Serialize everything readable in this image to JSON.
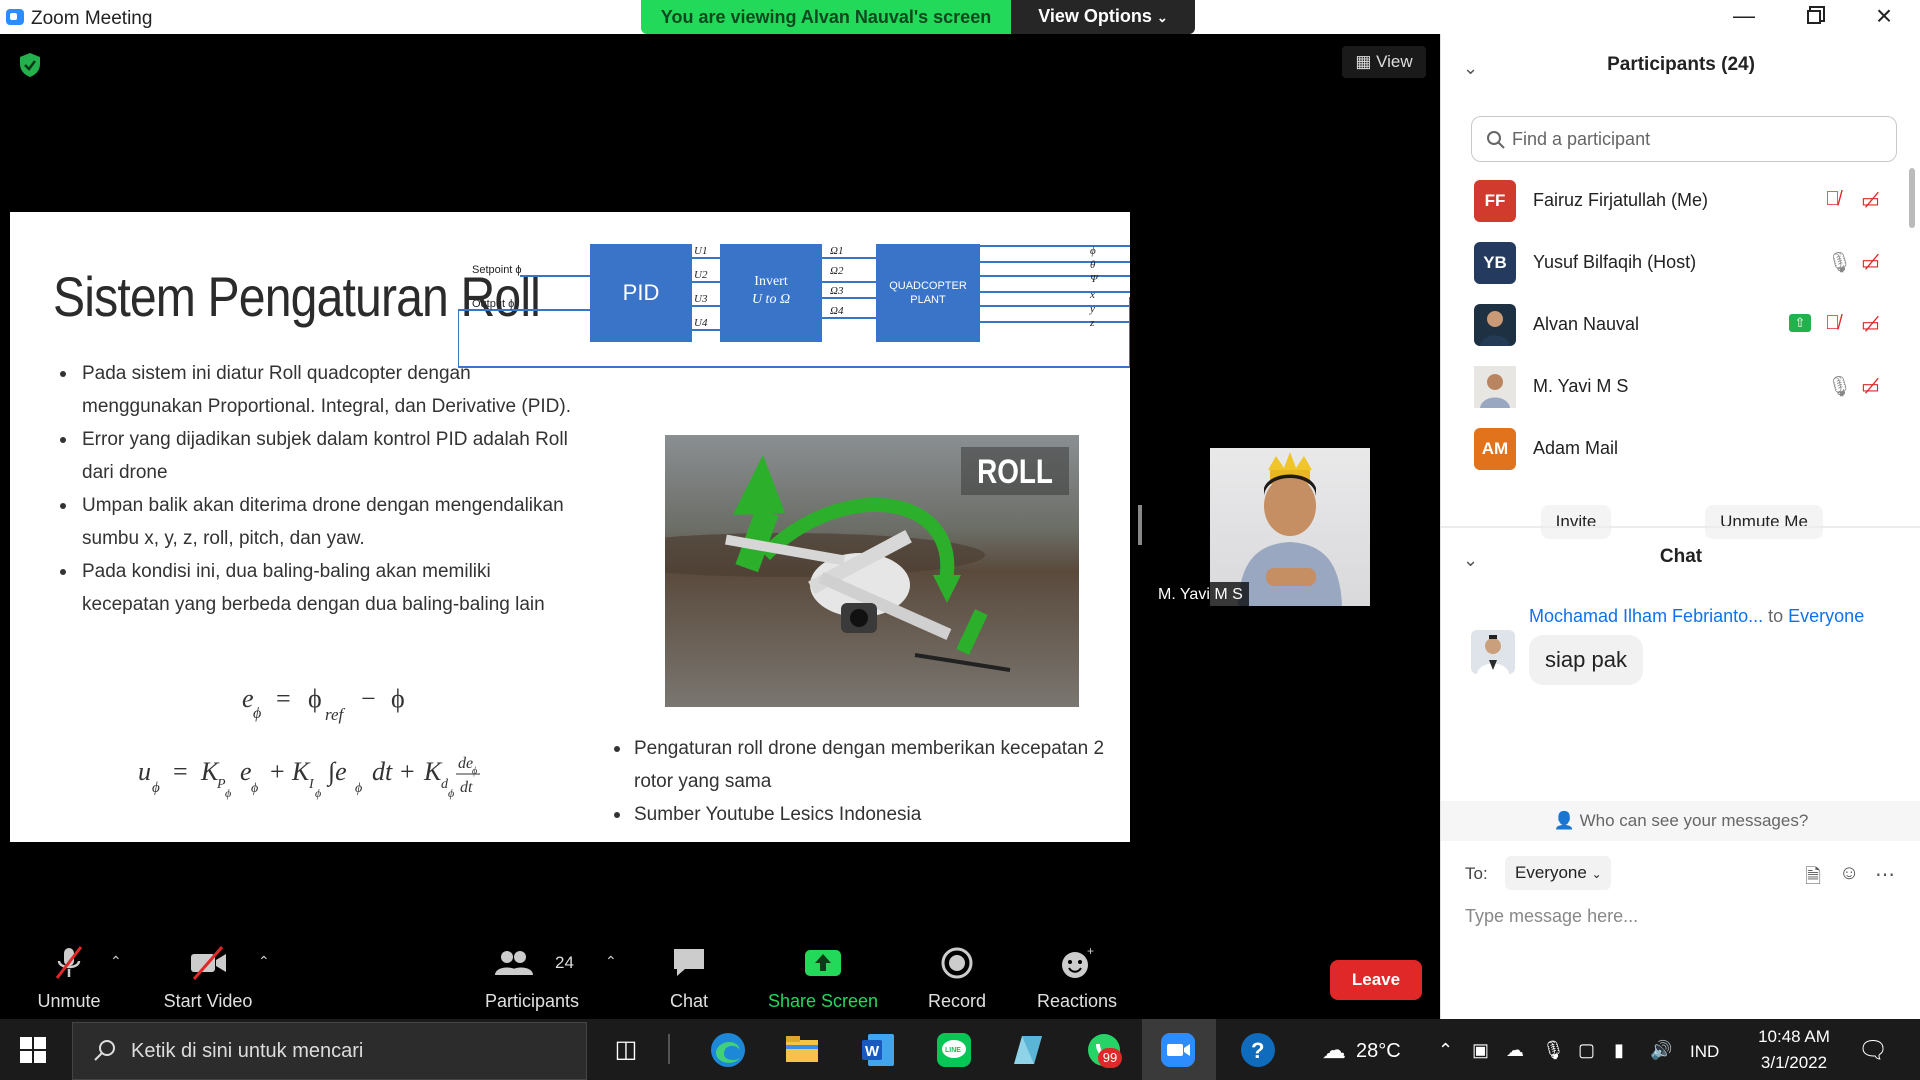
{
  "window": {
    "title": "Zoom Meeting",
    "viewing_banner": "You are viewing Alvan Nauval's screen",
    "view_options": "View Options",
    "view_button": "View"
  },
  "slide": {
    "title": "Sistem Pengaturan Roll",
    "bullets": [
      "Pada sistem ini diatur Roll quadcopter dengan menggunakan Proportional. Integral, dan Derivative (PID).",
      "Error yang dijadikan subjek dalam kontrol PID adalah Roll dari drone",
      "Umpan balik akan diterima drone dengan mengendalikan sumbu x, y, z, roll, pitch, dan yaw.",
      "Pada kondisi ini, dua baling-baling akan memiliki kecepatan yang berbeda dengan dua baling-baling lain"
    ],
    "right_bullets": [
      "Pengaturan roll drone dengan memberikan kecepatan 2 rotor yang sama",
      "Sumber Youtube Lesics Indonesia"
    ],
    "diagram": {
      "setpoint": "Setpoint ϕ",
      "output": "Output ϕ",
      "pid": "PID",
      "invert_1": "Invert",
      "invert_2": "U to Ω",
      "plant_1": "QUADCOPTER",
      "plant_2": "PLANT",
      "u_labels": [
        "U1",
        "U2",
        "U3",
        "U4"
      ],
      "omega_labels": [
        "Ω1",
        "Ω2",
        "Ω3",
        "Ω4"
      ],
      "out_labels": [
        "ϕ",
        "θ",
        "Ψ",
        "x",
        "y",
        "z"
      ]
    },
    "photo_label": "ROLL"
  },
  "camera": {
    "name": "M. Yavi M S"
  },
  "toolbar": {
    "unmute": "Unmute",
    "start_video": "Start Video",
    "participants": "Participants",
    "participant_count": "24",
    "chat": "Chat",
    "share_screen": "Share Screen",
    "record": "Record",
    "reactions": "Reactions",
    "leave": "Leave"
  },
  "participants": {
    "header": "Participants (24)",
    "search_placeholder": "Find a participant",
    "list": [
      {
        "initials": "FF",
        "name": "Fairuz Firjatullah (Me)",
        "avatar_color": "#d13b2e"
      },
      {
        "initials": "YB",
        "name": "Yusuf Bilfaqih (Host)",
        "avatar_color": "#243a5e"
      },
      {
        "initials": "",
        "name": "Alvan Nauval",
        "avatar_color": "#1d3142"
      },
      {
        "initials": "",
        "name": "M. Yavi M S",
        "avatar_color": "#b8a07a"
      },
      {
        "initials": "AM",
        "name": "Adam Mail",
        "avatar_color": "#e0731c"
      }
    ],
    "invite": "Invite",
    "unmute_me": "Unmute Me"
  },
  "chat": {
    "header": "Chat",
    "sender": "Mochamad Ilham Febrianto...",
    "to_word": "to",
    "to_target": "Everyone",
    "message": "siap pak",
    "who_can_see": "Who can see your messages?",
    "to_label": "To:",
    "recipient": "Everyone",
    "placeholder": "Type message here..."
  },
  "taskbar": {
    "search": "Ketik di sini untuk mencari",
    "weather": "28°C",
    "lang": "IND",
    "time": "10:48 AM",
    "date": "3/1/2022",
    "whatsapp_badge": "99"
  },
  "colors": {
    "zoom_blue": "#2d8cff",
    "share_green": "#23d959",
    "leave_red": "#e02828",
    "muted_red": "#e02828",
    "link_blue": "#0e72ed",
    "diagram_blue": "#3a74c9"
  }
}
